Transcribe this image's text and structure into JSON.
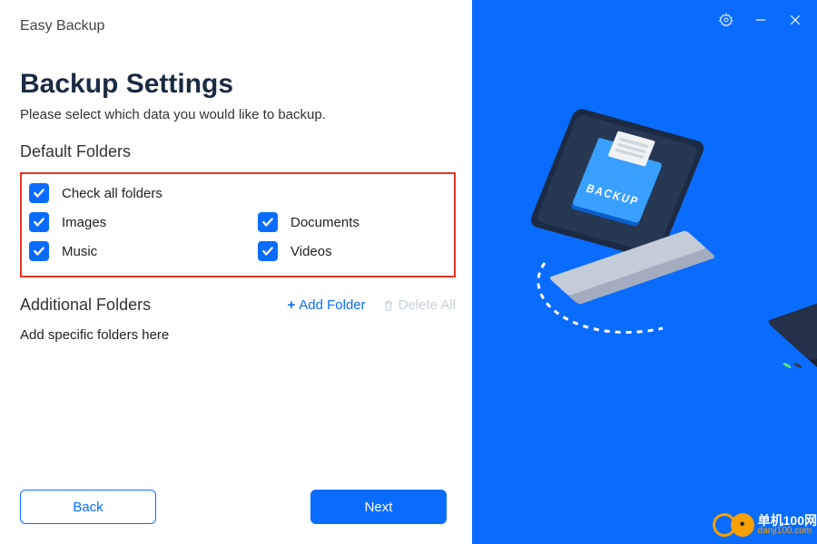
{
  "app_title": "Easy Backup",
  "page_title": "Backup Settings",
  "subtitle": "Please select which data you would like to backup.",
  "sections": {
    "default_folders_label": "Default Folders",
    "additional_folders_label": "Additional Folders"
  },
  "folders": {
    "check_all": {
      "label": "Check all folders",
      "checked": true
    },
    "images": {
      "label": "Images",
      "checked": true
    },
    "documents": {
      "label": "Documents",
      "checked": true
    },
    "music": {
      "label": "Music",
      "checked": true
    },
    "videos": {
      "label": "Videos",
      "checked": true
    }
  },
  "actions": {
    "add_folder_label": "Add Folder",
    "delete_all_label": "Delete All"
  },
  "additional_placeholder": "Add specific folders here",
  "buttons": {
    "back": "Back",
    "next": "Next"
  },
  "illustration": {
    "folder_text": "BACKUP"
  },
  "watermark": {
    "cn": "单机100网",
    "url": "danji100.com"
  },
  "colors": {
    "accent": "#0a6cff",
    "highlight_border": "#e93323"
  }
}
